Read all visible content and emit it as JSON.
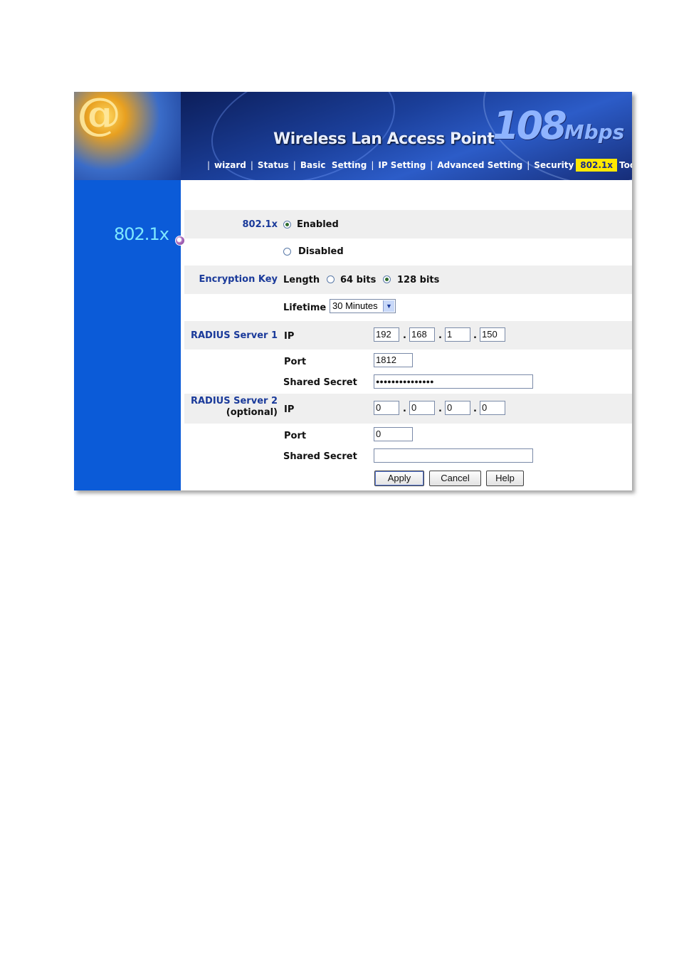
{
  "header": {
    "at_symbol": "@",
    "title": "Wireless Lan Access Point",
    "speed_number": "108",
    "speed_unit": "Mbps"
  },
  "nav": {
    "items": [
      {
        "label": "wizard"
      },
      {
        "label": "Status"
      },
      {
        "label": "Basic  Setting"
      },
      {
        "label": "IP Setting"
      },
      {
        "label": "Advanced Setting"
      },
      {
        "label": "Security"
      },
      {
        "label": "802.1x",
        "active": true
      },
      {
        "label": "Tools"
      }
    ],
    "separator": "|"
  },
  "sidebar": {
    "title": "802.1x"
  },
  "form": {
    "dot1x_label": "802.1x",
    "enabled_label": "Enabled",
    "disabled_label": "Disabled",
    "dot1x_selected": "Enabled",
    "encryption_key_label": "Encryption Key",
    "length_label": "Length",
    "bits64_label": "64 bits",
    "bits128_label": "128 bits",
    "length_selected": "128 bits",
    "lifetime_label": "Lifetime",
    "lifetime_value": "30 Minutes",
    "radius1_label": "RADIUS Server 1",
    "radius1_ip_label": "IP",
    "radius1_ip": [
      "192",
      "168",
      "1",
      "150"
    ],
    "radius1_port_label": "Port",
    "radius1_port": "1812",
    "radius1_secret_label": "Shared Secret",
    "radius1_secret": "●●●●●●●●●●●●●●●",
    "radius2_label": "RADIUS Server 2",
    "radius2_optional": "(optional)",
    "radius2_ip_label": "IP",
    "radius2_ip": [
      "0",
      "0",
      "0",
      "0"
    ],
    "radius2_port_label": "Port",
    "radius2_port": "0",
    "radius2_secret_label": "Shared Secret",
    "radius2_secret": "",
    "ip_separator": "."
  },
  "buttons": {
    "apply": "Apply",
    "cancel": "Cancel",
    "help": "Help"
  },
  "colors": {
    "sidebar": "#0b5bd8",
    "nav_active": "#ffe800",
    "label_blue": "#1a3a9a"
  }
}
